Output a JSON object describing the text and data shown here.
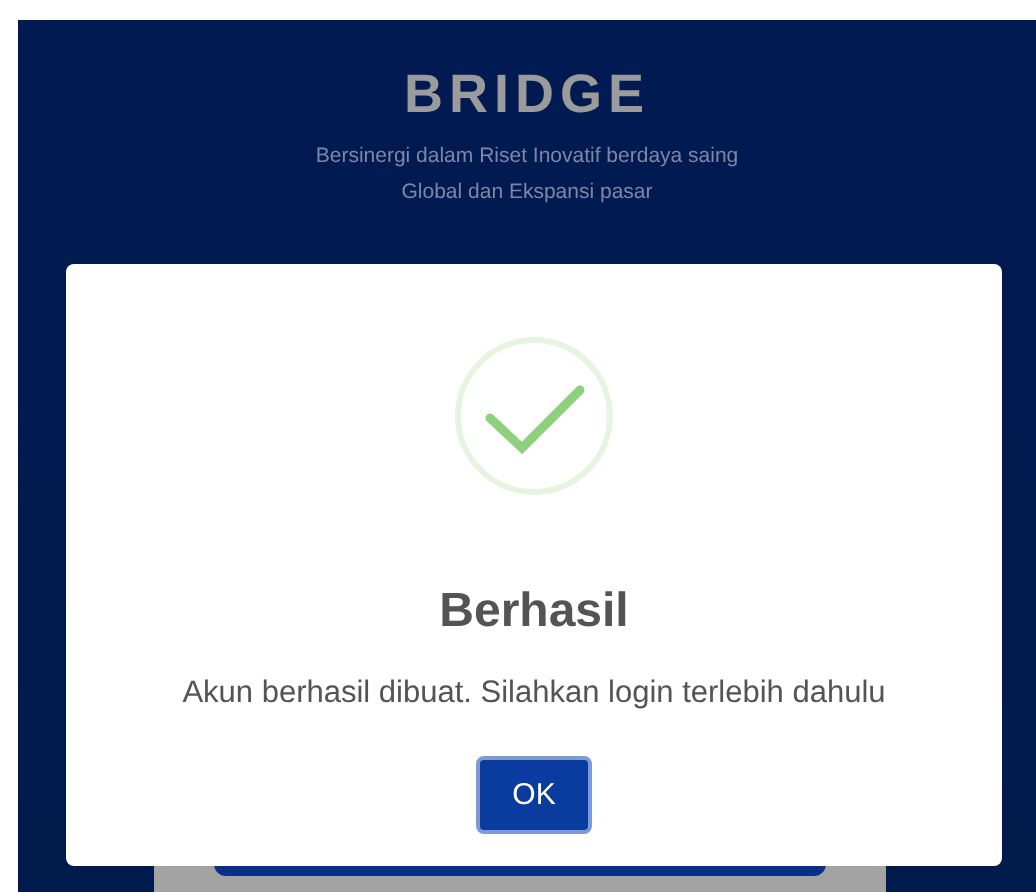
{
  "brand": {
    "title": "BRIDGE",
    "tagline_lines": [
      "Bersinergi dalam Riset Inovatif berdaya saing",
      "Global dan Ekspansi pasar"
    ]
  },
  "dialog": {
    "kind": "success",
    "title": "Berhasil",
    "message": "Akun berhasil dibuat. Silahkan login terlebih dahulu",
    "buttons": [
      "OK"
    ]
  }
}
